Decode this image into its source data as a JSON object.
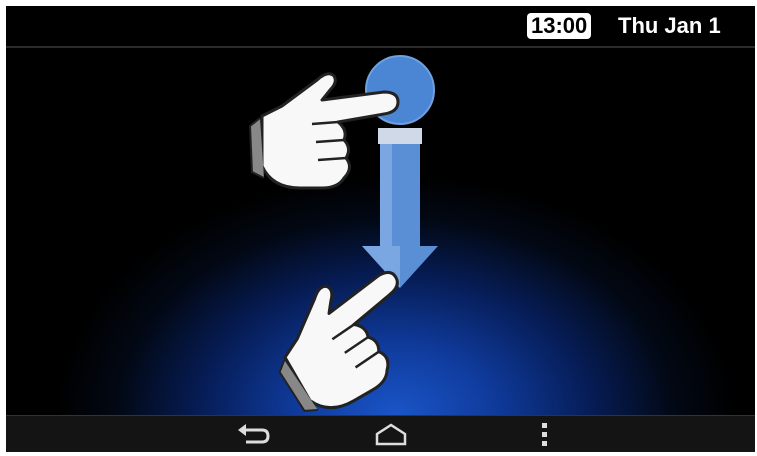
{
  "status_bar": {
    "time": "13:00",
    "date": "Thu Jan 1"
  },
  "gesture_illustration": {
    "gesture": "drag-down",
    "icons": [
      "hand-pointer-icon",
      "touch-point-icon",
      "arrow-down-icon",
      "hand-pointer-icon"
    ]
  },
  "nav_bar": {
    "buttons": [
      "back-icon",
      "home-icon",
      "menu-icon"
    ]
  },
  "colors": {
    "accent": "#4a86d4",
    "background": "#000000",
    "glow": "#1a55c8"
  }
}
